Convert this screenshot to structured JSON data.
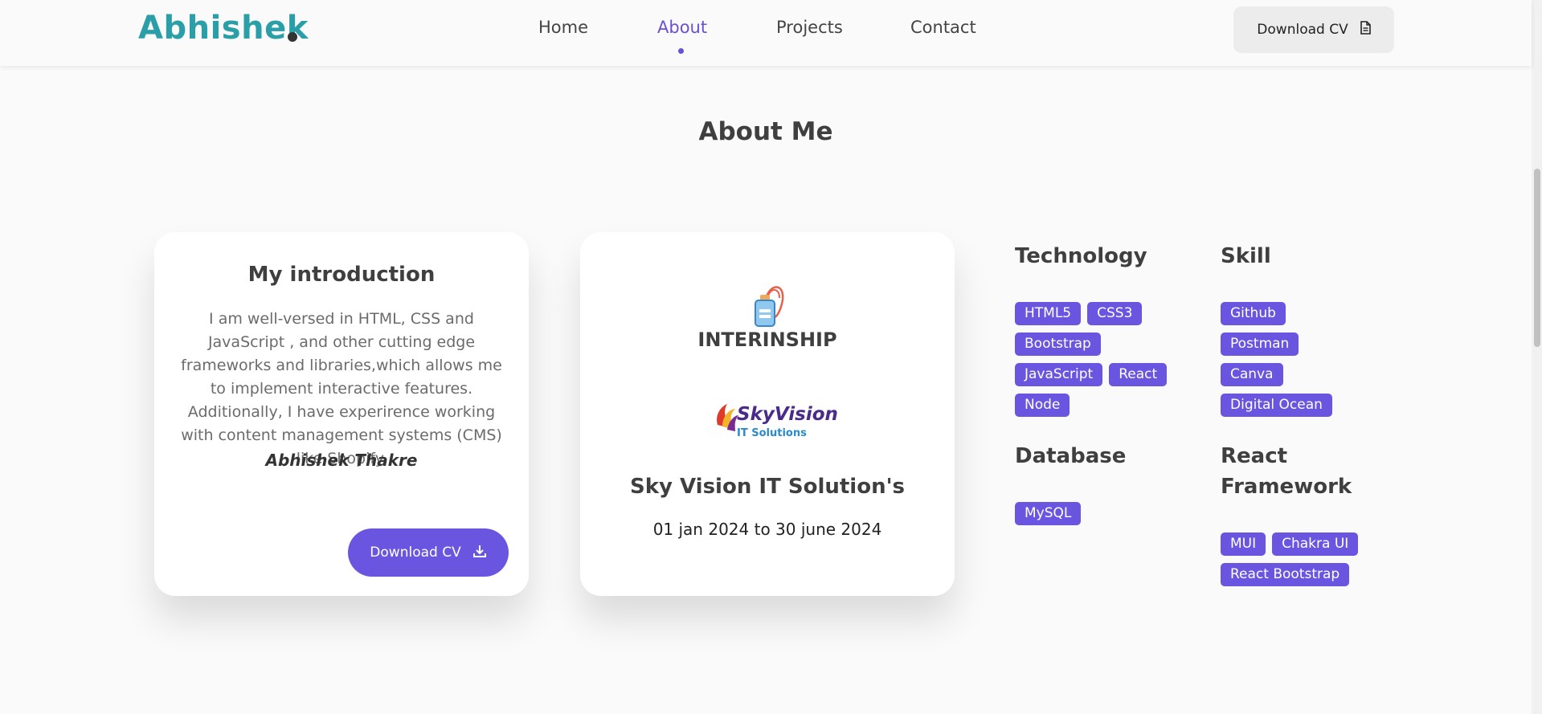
{
  "header": {
    "logo": "Abhishek",
    "nav": [
      "Home",
      "About",
      "Projects",
      "Contact"
    ],
    "active_nav": "About",
    "download_cv": "Download CV"
  },
  "section_title": "About Me",
  "intro": {
    "title": "My introduction",
    "text": "I am well-versed in HTML, CSS and JavaScript , and other cutting edge frameworks and libraries,which allows me to implement interactive features. Additionally, I have experirence working with content management systems (CMS) like Shopify.",
    "author": "Abhishek Thakre",
    "download_cv": "Download CV"
  },
  "internship": {
    "label": "INTERINSHIP",
    "company_logo_text": "SkyVision",
    "company_logo_sub": "IT Solutions",
    "company": "Sky Vision IT Solution's",
    "dates": "01 jan 2024 to 30 june 2024"
  },
  "technology": {
    "heading": "Technology",
    "tags": [
      "HTML5",
      "CSS3",
      "Bootstrap",
      "JavaScript",
      "React",
      "Node"
    ]
  },
  "skill": {
    "heading": "Skill",
    "tags": [
      "Github",
      "Postman",
      "Canva",
      "Digital Ocean"
    ]
  },
  "database": {
    "heading": "Database",
    "tags": [
      "MySQL"
    ]
  },
  "react_framework": {
    "heading_line1": "React",
    "heading_line2": "Framework",
    "tags": [
      "MUI",
      "Chakra UI",
      "React Bootstrap"
    ]
  },
  "colors": {
    "accent": "#6a55e0",
    "logo": "#2a9fa8"
  }
}
